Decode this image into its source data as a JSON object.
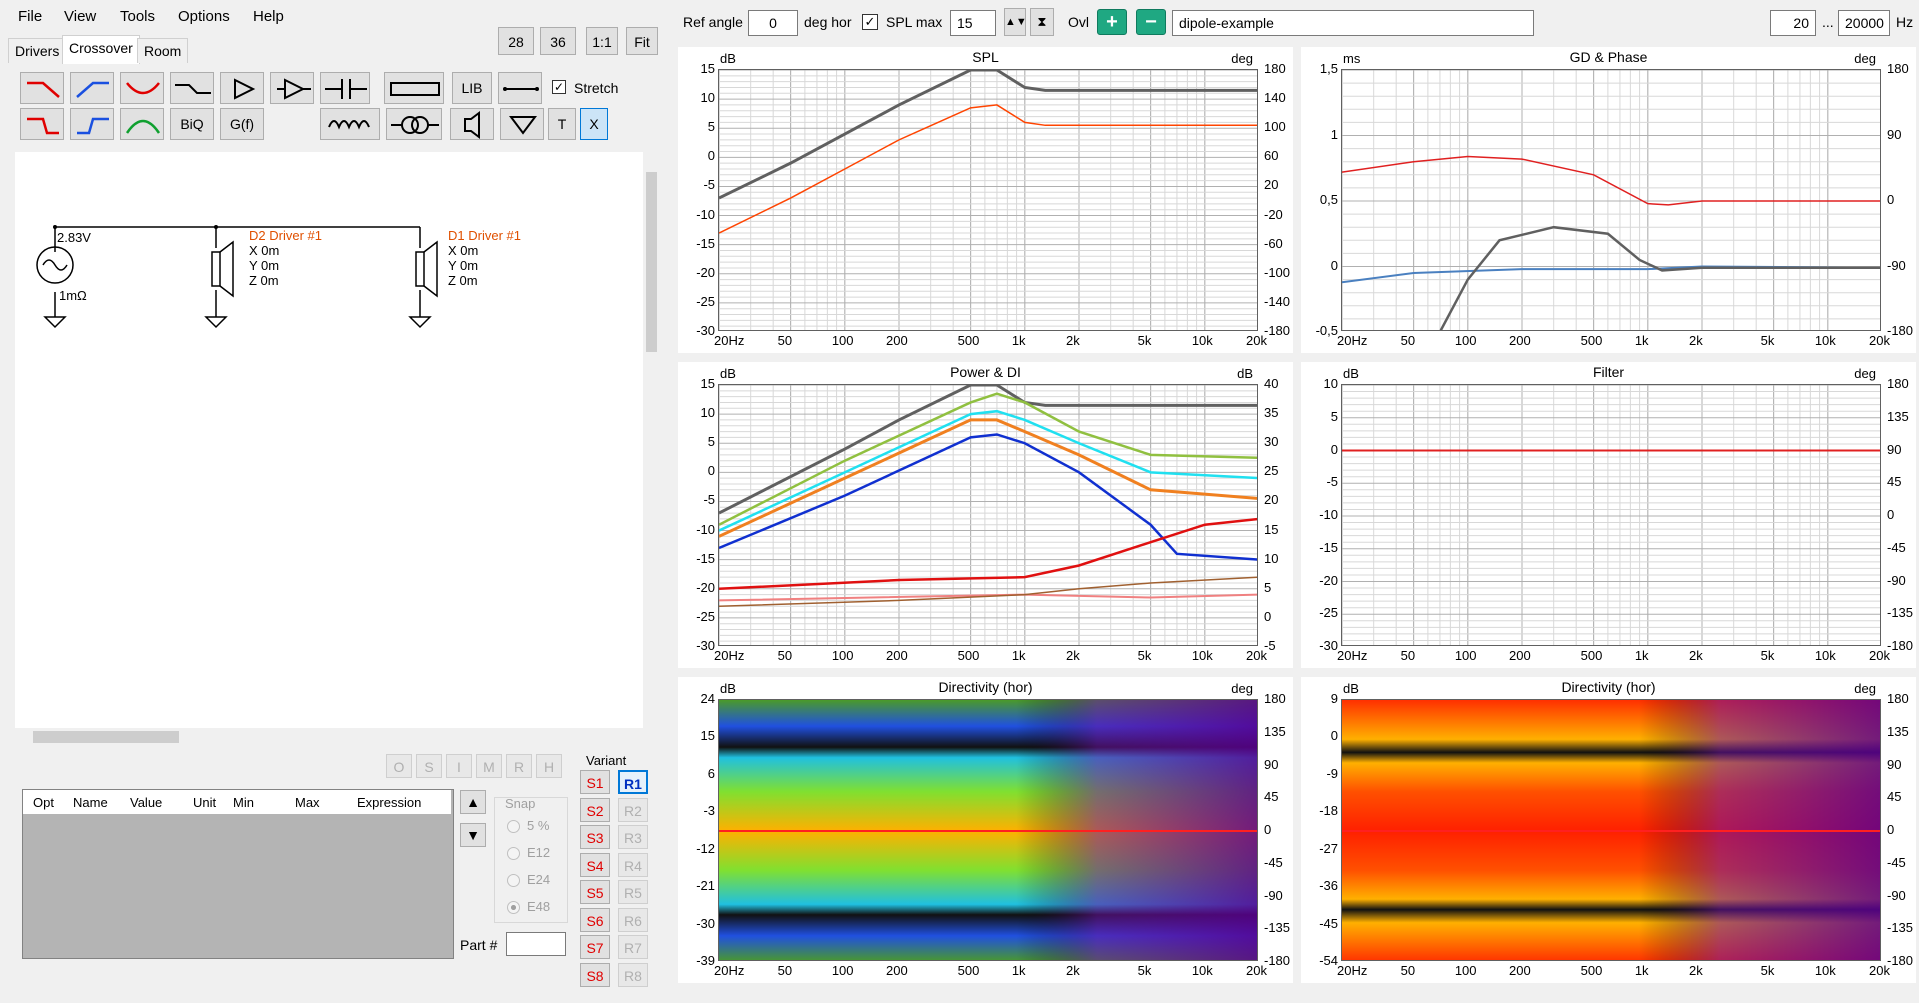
{
  "menu": [
    "File",
    "View",
    "Tools",
    "Options",
    "Help"
  ],
  "tabs": [
    "Drivers",
    "Crossover",
    "Room"
  ],
  "zoom_buttons": [
    "28",
    "36",
    "1:1",
    "Fit"
  ],
  "toolbar": {
    "lib": "LIB",
    "biq": "BiQ",
    "gf": "G(f)",
    "t": "T",
    "x": "X",
    "stretch": "Stretch"
  },
  "schematic": {
    "voltage": "2.83V",
    "resistance": "1mΩ",
    "d2": {
      "name": "D2 Driver #1",
      "x": "X 0m",
      "y": "Y 0m",
      "z": "Z 0m"
    },
    "d1": {
      "name": "D1 Driver #1",
      "x": "X 0m",
      "y": "Y 0m",
      "z": "Z 0m"
    }
  },
  "opt_buttons": [
    "O",
    "S",
    "I",
    "M",
    "R",
    "H"
  ],
  "param_headers": [
    "Opt",
    "Name",
    "Value",
    "Unit",
    "Min",
    "Max",
    "Expression"
  ],
  "snap": {
    "label": "Snap",
    "options": [
      "5 %",
      "E12",
      "E24",
      "E48"
    ]
  },
  "variant": {
    "label": "Variant",
    "s": [
      "S1",
      "S2",
      "S3",
      "S4",
      "S5",
      "S6",
      "S7",
      "S8"
    ],
    "r": [
      "R1",
      "R2",
      "R3",
      "R4",
      "R5",
      "R6",
      "R7",
      "R8"
    ]
  },
  "part_label": "Part #",
  "top": {
    "ref_angle_label": "Ref angle",
    "ref_angle": "0",
    "deg_hor": "deg hor",
    "spl_max_label": "SPL max",
    "spl_max": "15",
    "ovl": "Ovl",
    "name": "dipole-example",
    "f_min": "20",
    "dots": "...",
    "f_max": "20000",
    "hz": "Hz"
  },
  "freq_ticks": [
    "20Hz",
    "50",
    "100",
    "200",
    "500",
    "1k",
    "2k",
    "5k",
    "10k",
    "20k"
  ],
  "charts": {
    "spl": {
      "title": "SPL",
      "lunit": "dB",
      "runit": "deg",
      "left": [
        "15",
        "10",
        "5",
        "0",
        "-5",
        "-10",
        "-15",
        "-20",
        "-25",
        "-30"
      ],
      "right": [
        "180",
        "140",
        "100",
        "60",
        "20",
        "-20",
        "-60",
        "-100",
        "-140",
        "-180"
      ]
    },
    "gd": {
      "title": "GD & Phase",
      "lunit": "ms",
      "runit": "deg",
      "left": [
        "1,5",
        "1",
        "0,5",
        "0",
        "-0,5"
      ],
      "right": [
        "180",
        "90",
        "0",
        "-90",
        "-180"
      ]
    },
    "power": {
      "title": "Power & DI",
      "lunit": "dB",
      "runit": "dB",
      "left": [
        "15",
        "10",
        "5",
        "0",
        "-5",
        "-10",
        "-15",
        "-20",
        "-25",
        "-30"
      ],
      "right": [
        "40",
        "35",
        "30",
        "25",
        "20",
        "15",
        "10",
        "5",
        "0",
        "-5"
      ]
    },
    "filter": {
      "title": "Filter",
      "lunit": "dB",
      "runit": "deg",
      "left": [
        "10",
        "5",
        "0",
        "-5",
        "-10",
        "-15",
        "-20",
        "-25",
        "-30"
      ],
      "right": [
        "180",
        "135",
        "90",
        "45",
        "0",
        "-45",
        "-90",
        "-135",
        "-180"
      ]
    },
    "dir1": {
      "title": "Directivity (hor)",
      "lunit": "dB",
      "runit": "deg",
      "left": [
        "24",
        "15",
        "6",
        "-3",
        "-12",
        "-21",
        "-30",
        "-39"
      ],
      "right": [
        "180",
        "135",
        "90",
        "45",
        "0",
        "-45",
        "-90",
        "-135",
        "-180"
      ]
    },
    "dir2": {
      "title": "Directivity (hor)",
      "lunit": "dB",
      "runit": "deg",
      "left": [
        "9",
        "0",
        "-9",
        "-18",
        "-27",
        "-36",
        "-45",
        "-54"
      ],
      "right": [
        "180",
        "135",
        "90",
        "45",
        "0",
        "-45",
        "-90",
        "-135",
        "-180"
      ]
    }
  },
  "colors": {
    "grid": "#d8d8d8",
    "gridMajor": "#b0b0b0",
    "accent_blue": "#0078d7"
  }
}
